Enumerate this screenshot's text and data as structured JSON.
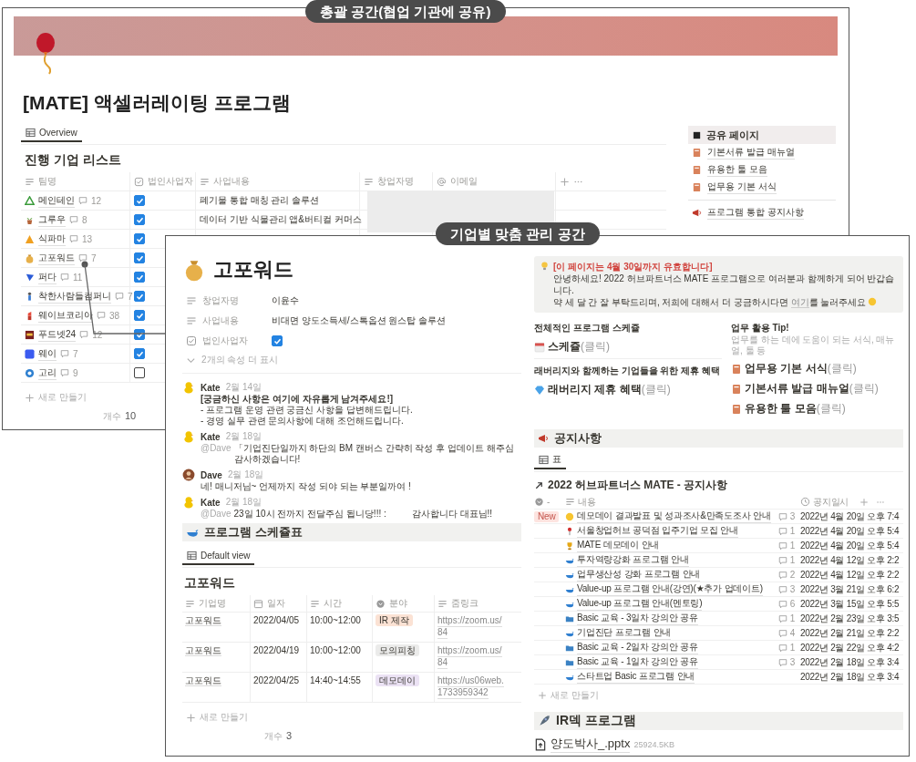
{
  "overview": {
    "badge": "총괄 공간(협업 기관에 공유)",
    "title": "[MATE] 액셀러레이팅 프로그램",
    "view_tab": "Overview",
    "list_title": "진행 기업 리스트",
    "columns": [
      {
        "label": "팀명",
        "kind": "title"
      },
      {
        "label": "법인사업자",
        "kind": "checkbox"
      },
      {
        "label": "사업내용",
        "kind": "text"
      },
      {
        "label": "창업자명",
        "kind": "text"
      },
      {
        "label": "이메일",
        "kind": "email"
      }
    ],
    "rows": [
      {
        "name": "메인테인",
        "comments": "12",
        "corporate": true,
        "business": "폐기물 통합 매칭 관리 솔루션"
      },
      {
        "name": "그루우",
        "comments": "8",
        "corporate": true,
        "business": "데이터 기반 식물관리 앱&버티컬 커머스"
      },
      {
        "name": "식파마",
        "comments": "13",
        "corporate": true
      },
      {
        "name": "고포워드",
        "comments": "7",
        "corporate": true
      },
      {
        "name": "퍼다",
        "comments": "11",
        "corporate": true
      },
      {
        "name": "착한사람들컴퍼니",
        "comments": "7",
        "corporate": true
      },
      {
        "name": "웨이브코리아",
        "comments": "38",
        "corporate": true
      },
      {
        "name": "푸드넷24",
        "comments": "12",
        "corporate": true
      },
      {
        "name": "웨이",
        "comments": "7",
        "corporate": true
      },
      {
        "name": "고리",
        "comments": "9",
        "corporate": false
      }
    ],
    "new_row": "새로 만들기",
    "count_label": "개수",
    "count": "10",
    "sidebar": {
      "title": "공유 페이지",
      "pages": [
        "기본서류 발급 매뉴얼",
        "유용한 툴 모음",
        "업무용 기본 서식"
      ],
      "notice": "프로그램 통합 공지사항"
    }
  },
  "company": {
    "badge": "기업별 맞춤 관리 공간",
    "title": "고포워드",
    "properties": [
      {
        "kind": "text",
        "label": "창업자명",
        "value": "이윤수"
      },
      {
        "kind": "text",
        "label": "사업내용",
        "value": "비대면 양도소득세/스톡옵션 원스탑 솔루션"
      },
      {
        "kind": "checkbox",
        "label": "법인사업자",
        "checked": true
      }
    ],
    "more_properties": "2개의 속성 더 표시",
    "comments": [
      {
        "author": "Kate",
        "date": "2월 14일",
        "lines": [
          {
            "text": "[궁금하신 사항은 여기에 자유롭게 남겨주세요!]",
            "bold": true
          },
          {
            "text": "- 프로그램 운영 관련 궁금신 사항을 답변해드립니다.",
            "bold": false
          },
          {
            "text": "- 경영 실무 관련 문의사항에 대해 조언해드립니다.",
            "bold": false
          }
        ]
      },
      {
        "author": "Kate",
        "date": "2월 18일",
        "lines": [
          {
            "mention": "@Dave",
            "text": "「기업진단일까지 하단의 BM 캔버스 간략히 작성 후 업데이트 해주심 감사하겠습니다!",
            "bold": false
          }
        ]
      },
      {
        "author": "Dave",
        "date": "2월 18일",
        "lines": [
          {
            "text": "네! 매니저님~ 언제까지 작성 되야 되는 부분일까여 !",
            "bold": false
          }
        ]
      },
      {
        "author": "Kate",
        "date": "2월 18일",
        "lines": [
          {
            "mention": "@Dave",
            "text": "23일 10시 전까지 전달주심 됩니당!!! :",
            "aside": "감사합니다 대표님!!",
            "bold": false
          }
        ]
      }
    ],
    "schedule": {
      "title": "프로그램 스케쥴표",
      "view_tab": "Default view",
      "heading": "고포워드",
      "columns": [
        {
          "label": "기업명",
          "kind": "title"
        },
        {
          "label": "일자",
          "kind": "date"
        },
        {
          "label": "시간",
          "kind": "text"
        },
        {
          "label": "분야",
          "kind": "select"
        },
        {
          "label": "줌링크",
          "kind": "text"
        }
      ],
      "rows": [
        {
          "company": "고포워드",
          "date": "2022/04/05",
          "time": "10:00~12:00",
          "field": "IR 제작",
          "color": "#fbe2d4",
          "link": [
            "https://zoom.us/",
            "84"
          ]
        },
        {
          "company": "고포워드",
          "date": "2022/04/19",
          "time": "10:00~12:00",
          "field": "모의피칭",
          "color": "#ebebea",
          "link": [
            "https://zoom.us/",
            "84"
          ]
        },
        {
          "company": "고포워드",
          "date": "2022/04/25",
          "time": "14:40~14:55",
          "field": "데모데이",
          "color": "#ebe2f4",
          "link": [
            "https://us06web.",
            "1733959342"
          ]
        }
      ],
      "new_row": "새로 만들기",
      "count_label": "개수",
      "count": "3"
    },
    "callout": {
      "title": "[이 페이지는 4월 30일까지 유효합니다]",
      "lines": [
        "안녕하세요! 2022 허브파트너스 MATE 프로그램으로 여러분과 함께하게 되어 반갑습니다."
      ],
      "last_line": {
        "before": "약 세 달 간 잘 부탁드리며, 저희에 대해서 더 궁금하시다면 ",
        "link": "여기",
        "after": "를 눌러주세요"
      }
    },
    "resources": {
      "left": [
        {
          "heading": "전체적인 프로그램 스케쥴",
          "label": "스케쥴",
          "hint": "(클릭)"
        },
        {
          "heading": "래버리지와 함께하는 기업들을 위한 제휴 혜택",
          "label": "래버리지 제휴 혜택",
          "hint": "(클릭)"
        }
      ],
      "tip_title": "업무 활용 Tip!",
      "tip_subtitle": "업무를 하는 데에 도움이 되는 서식, 매뉴얼, 툴 등",
      "tips": [
        {
          "label": "업무용 기본 서식",
          "hint": "(클릭)"
        },
        {
          "label": "기본서류 발급 매뉴얼",
          "hint": "(클릭)"
        },
        {
          "label": "유용한 툴 모음",
          "hint": "(클릭)"
        }
      ]
    },
    "notices": {
      "title": "공지사항",
      "view_tab": "표",
      "database": "2022 허브파트너스 MATE - 공지사항",
      "columns": [
        {
          "label": "-",
          "kind": "select"
        },
        {
          "label": "내용",
          "kind": "title"
        },
        {
          "label": "공지일시",
          "kind": "created"
        }
      ],
      "rows": [
        {
          "tag": "New",
          "title": "데모데이 결과발표 및 성과조사&만족도조사 안내",
          "comments": "3",
          "date": "2022년 4월 20일 오후 7:4"
        },
        {
          "title": "서울창업허브 공덕점 입주기업 모집 안내",
          "comments": "1",
          "date": "2022년 4월 20일 오후 5:4"
        },
        {
          "title": "MATE 데모데이 안내",
          "comments": "1",
          "date": "2022년 4월 20일 오후 5:4"
        },
        {
          "title": "투자역량강화 프로그램 안내",
          "comments": "1",
          "date": "2022년 4월 12일 오후 2:2"
        },
        {
          "title": "업무생산성 강화 프로그램 안내",
          "comments": "2",
          "date": "2022년 4월 12일 오후 2:2"
        },
        {
          "title": "Value-up 프로그램 안내(강연)(★추가 업데이트)",
          "comments": "3",
          "date": "2022년 3월 21일 오후 6:2"
        },
        {
          "title": "Value-up 프로그램 안내(멘토링)",
          "comments": "6",
          "date": "2022년 3월 15일 오후 5:5"
        },
        {
          "title": "Basic 교육 - 3일차 강의안 공유",
          "comments": "1",
          "date": "2022년 2월 23일 오후 3:5"
        },
        {
          "title": "기업진단 프로그램 안내",
          "comments": "4",
          "date": "2022년 2월 21일 오후 2:2"
        },
        {
          "title": "Basic 교육 - 2일차 강의안 공유",
          "comments": "1",
          "date": "2022년 2월 22일 오후 4:2"
        },
        {
          "title": "Basic 교육 - 1일차 강의안 공유",
          "comments": "3",
          "date": "2022년 2월 18일 오후 3:4"
        },
        {
          "title": "스타트업 Basic 프로그램 안내",
          "date": "2022년 2월 18일 오후 3:4"
        }
      ],
      "new_row": "새로 만들기"
    },
    "ir": {
      "title": "IR덱 프로그램",
      "file": "양도박사_.pptx",
      "size": "25924.5KB"
    }
  }
}
